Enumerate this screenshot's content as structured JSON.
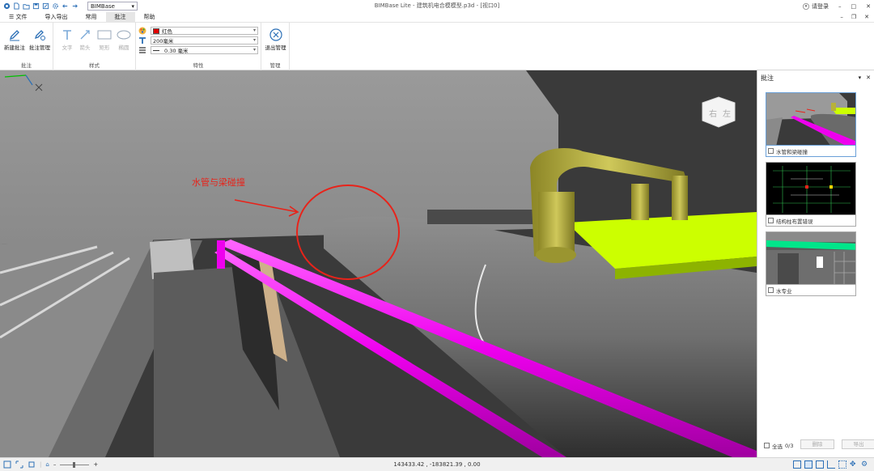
{
  "app": {
    "title": "BIMBase Lite - 建筑机电合模模型.p3d - [视口0]",
    "workspace": "BIMBase",
    "login": "请登录"
  },
  "menus": [
    "文件",
    "导入导出",
    "常用",
    "批注",
    "帮助"
  ],
  "active_menu": "批注",
  "ribbon": {
    "groups": [
      {
        "label": "批注",
        "buttons": [
          "新建批注",
          "批注管理"
        ]
      },
      {
        "label": "样式",
        "buttons": [
          "文字",
          "箭头",
          "矩形",
          "椭圆"
        ]
      },
      {
        "label": "特性"
      },
      {
        "label": "管理",
        "buttons": [
          "退出管理"
        ]
      }
    ],
    "properties": {
      "color_value": "红色",
      "color_hex": "#e00000",
      "font_value": "200毫米",
      "line_value": "0.30 毫米"
    }
  },
  "viewport": {
    "annotation_text": "水管与梁碰撞",
    "annotation_color": "#e8231a",
    "viewcube_labels": [
      "右",
      "左"
    ]
  },
  "panel": {
    "title": "批注",
    "items": [
      {
        "label": "水管和梁碰撞",
        "checked": false,
        "selected": true
      },
      {
        "label": "结构柱布置错误",
        "checked": false,
        "selected": false
      },
      {
        "label": "水专业",
        "checked": false,
        "selected": false
      }
    ],
    "footer": {
      "select_all": "全选",
      "count": "0/3",
      "delete": "删除",
      "export": "导出"
    }
  },
  "status": {
    "coords": "143433.42 , -183821.39 , 0.00"
  },
  "colors": {
    "accent": "#2b6fb6",
    "pipe_magenta": "#ff00ff",
    "duct_green": "#ccff00",
    "pipe_olive": "#b7b13a"
  }
}
